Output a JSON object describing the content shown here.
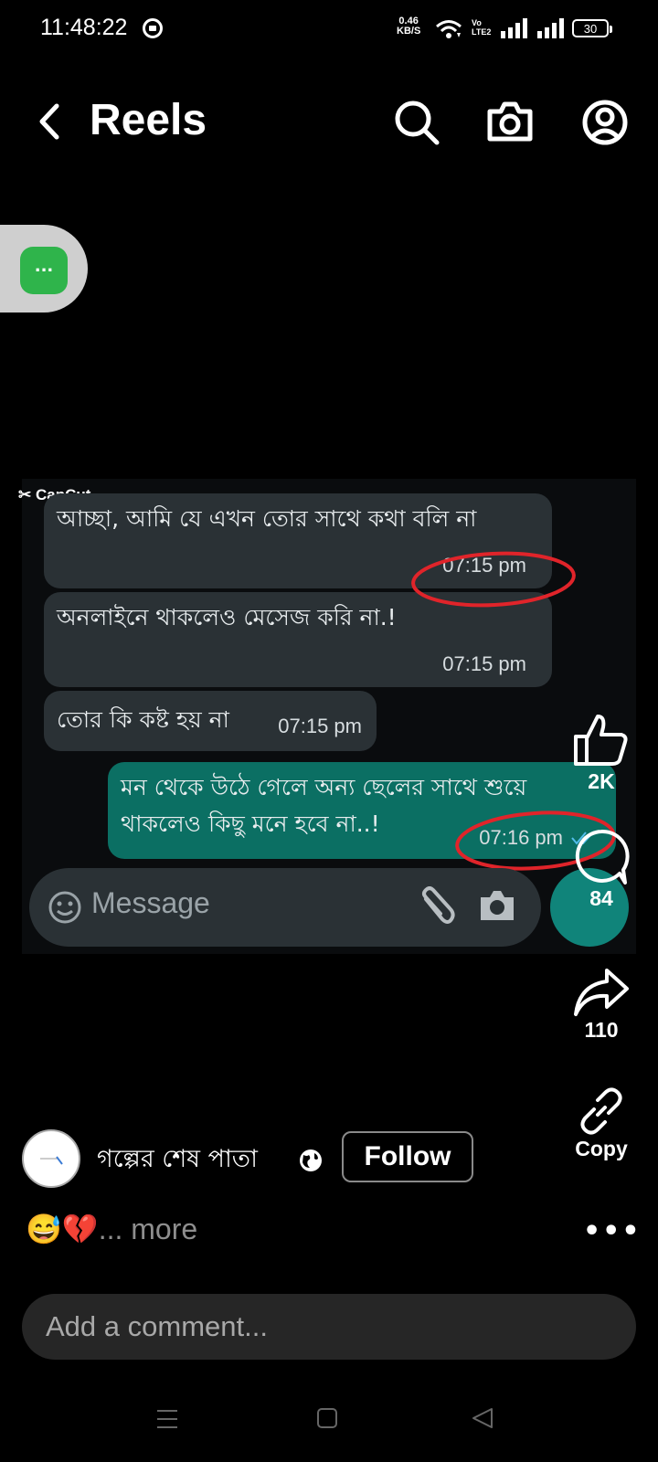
{
  "status_bar": {
    "time": "11:48:22",
    "net_speed_value": "0.46",
    "net_speed_unit": "KB/S",
    "volte_top": "Vo",
    "volte_bottom": "LTE2",
    "battery": "30"
  },
  "header": {
    "title": "Reels",
    "icons": [
      "back-chevron-icon",
      "search-icon",
      "camera-icon",
      "profile-icon"
    ]
  },
  "floating_bubble": {
    "label": "..."
  },
  "video": {
    "watermark": "CapCut",
    "messages": [
      {
        "text": "আচ্ছা, আমি যে এখন তোর সাথে কথা বলি না",
        "time": "07:15 pm",
        "direction": "incoming"
      },
      {
        "text": "অনলাইনে থাকলেও মেসেজ করি না.!",
        "time": "07:15 pm",
        "direction": "incoming"
      },
      {
        "text": "তোর কি কষ্ট হয় না",
        "time": "07:15 pm",
        "direction": "incoming"
      },
      {
        "text_line1": "মন থেকে উঠে গেলে অন্য ছেলের সাথে শুয়ে",
        "text_line2": "থাকলেও কিছু মনে হবে না..!",
        "time": "07:16 pm",
        "direction": "outgoing"
      }
    ],
    "input_placeholder": "Message",
    "highlight_color": "#e0242a"
  },
  "actions": {
    "likes": "2K",
    "comments": "84",
    "shares": "110",
    "copy_label": "Copy"
  },
  "post": {
    "author": "গল্পের শেষ পাতা",
    "follow_label": "Follow",
    "caption_emojis": "😅💔",
    "caption_more": "... more",
    "more_options": "•••"
  },
  "comment": {
    "placeholder": "Add a comment..."
  },
  "colors": {
    "accent_green": "#10847a",
    "outgoing_bubble": "#0b6f63",
    "incoming_bubble": "#2a3135"
  }
}
